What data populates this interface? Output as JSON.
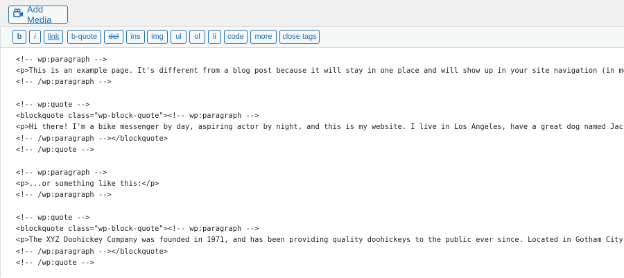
{
  "add_media": {
    "label": "Add Media",
    "icon": "media-camera-icon"
  },
  "toolbar": {
    "buttons": [
      "b",
      "i",
      "link",
      "b-quote",
      "del",
      "ins",
      "img",
      "ul",
      "ol",
      "li",
      "code",
      "more",
      "close tags"
    ]
  },
  "code_lines": [
    "<!-- wp:paragraph -->",
    "<p>This is an example page. It's different from a blog post because it will stay in one place and will show up in your site navigation (in most the",
    "<!-- /wp:paragraph -->",
    "",
    "<!-- wp:quote -->",
    "<blockquote class=\"wp-block-quote\"><!-- wp:paragraph -->",
    "<p>Hi there! I'm a bike messenger by day, aspiring actor by night, and this is my website. I live in Los Angeles, have a great dog named Jack, and",
    "<!-- /wp:paragraph --></blockquote>",
    "<!-- /wp:quote -->",
    "",
    "<!-- wp:paragraph -->",
    "<p>...or something like this:</p>",
    "<!-- /wp:paragraph -->",
    "",
    "<!-- wp:quote -->",
    "<blockquote class=\"wp-block-quote\"><!-- wp:paragraph -->",
    "<p>The XYZ Doohickey Company was founded in 1971, and has been providing quality doohickeys to the public ever since. Located in Gotham City, XYZ e",
    "<!-- /wp:paragraph --></blockquote>",
    "<!-- /wp:quote -->"
  ],
  "colors": {
    "accent": "#2271b1",
    "background": "#f0f0f1",
    "editor_background": "#ffffff",
    "text": "#1d2327"
  }
}
